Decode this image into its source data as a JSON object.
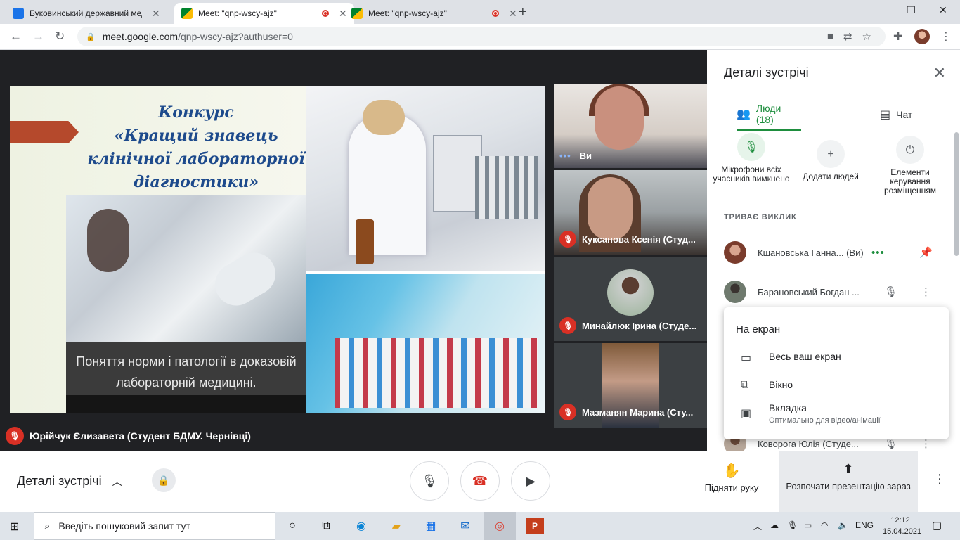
{
  "browser": {
    "tabs": [
      {
        "label": "Буковинський державний меді",
        "favicon_color": "#1a73e8",
        "active": false
      },
      {
        "label": "Meet: \"qnp-wscy-ajz\"",
        "favicon_color": "#00832d",
        "active": true
      },
      {
        "label": "Meet: \"qnp-wscy-ajz\"",
        "favicon_color": "#00832d",
        "active": false
      }
    ],
    "url_host": "meet.google.com",
    "url_path": "/qnp-wscy-ajz?authuser=0"
  },
  "slide": {
    "title_lines": [
      "Конкурс",
      "«Кращий знавець",
      "клінічної лабораторної",
      "діагностики»"
    ],
    "caption_lines": [
      "Поняття норми і патології в доказовій",
      "лабораторній медицині."
    ]
  },
  "presenter_name": "Юрійчук Єлизавета (Студент БДМУ. Чернівці)",
  "tiles": [
    {
      "name": "Ви"
    },
    {
      "name": "Куксанова Ксенія (Студ..."
    },
    {
      "name": "Минайлюк Ірина (Студе..."
    },
    {
      "name": "Мазманян Марина (Сту..."
    }
  ],
  "panel": {
    "title": "Деталі зустрічі",
    "tab_people": "Люди (18)",
    "tab_chat": "Чат",
    "actions": [
      {
        "label": "Мікрофони всіх учасників вимкнено"
      },
      {
        "label": "Додати людей"
      },
      {
        "label": "Елементи керування розміщенням"
      }
    ],
    "section": "ТРИВАЄ ВИКЛИК",
    "people": [
      {
        "name": "Кшановська Ганна... (Ви)"
      },
      {
        "name": "Барановський Богдан ..."
      },
      {
        "name": "Коворога Юлія (Студе..."
      }
    ]
  },
  "present_menu": {
    "title": "На екран",
    "items": [
      {
        "label": "Весь ваш екран",
        "sub": ""
      },
      {
        "label": "Вікно",
        "sub": ""
      },
      {
        "label": "Вкладка",
        "sub": "Оптимально для відео/анімації"
      }
    ]
  },
  "bottom": {
    "details": "Деталі зустрічі",
    "raise_hand": "Підняти руку",
    "present_now": "Розпочати презентацію зараз"
  },
  "taskbar": {
    "search_placeholder": "Введіть пошуковий запит тут",
    "lang": "ENG",
    "time": "12:12",
    "date": "15.04.2021"
  },
  "colors": {
    "accent_green": "#1e8e3e",
    "mic_off_red": "#d93025"
  }
}
